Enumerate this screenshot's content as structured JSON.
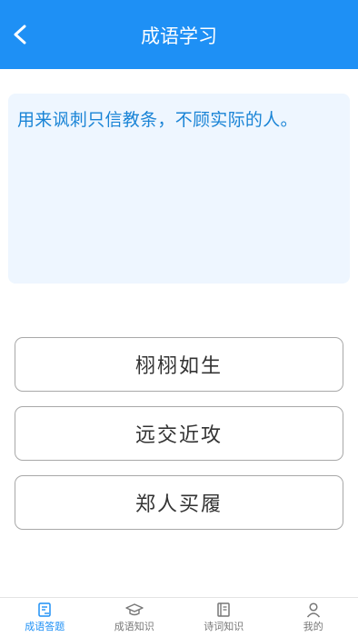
{
  "header": {
    "title": "成语学习",
    "back_icon": "chevron-left-icon"
  },
  "question": {
    "text": "用来讽刺只信教条，不顾实际的人。"
  },
  "options": [
    "栩栩如生",
    "远交近攻",
    "郑人买履"
  ],
  "tabbar": {
    "active_color": "#1e90f5",
    "items": [
      {
        "label": "成语答题",
        "icon": "quiz-icon",
        "active": true
      },
      {
        "label": "成语知识",
        "icon": "graduation-cap-icon",
        "active": false
      },
      {
        "label": "诗词知识",
        "icon": "book-icon",
        "active": false
      },
      {
        "label": "我的",
        "icon": "user-icon",
        "active": false
      }
    ]
  },
  "colors": {
    "header_bg": "#1e90f5",
    "question_text": "#1a84d6",
    "question_bg": "#eef6ff"
  }
}
